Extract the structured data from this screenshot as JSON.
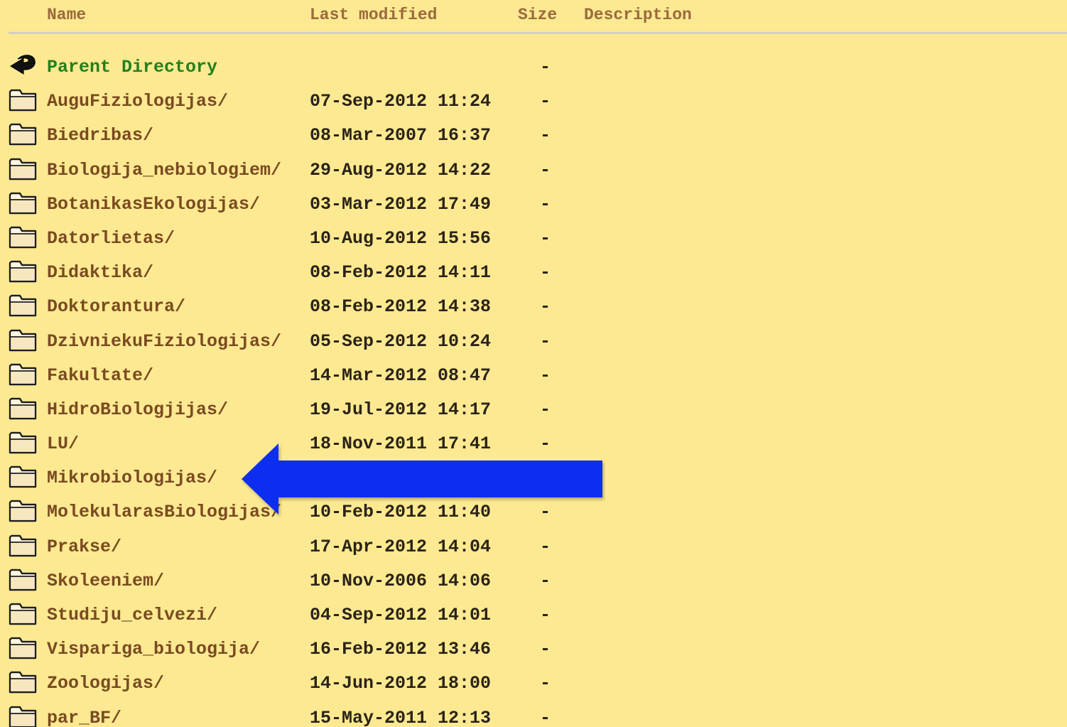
{
  "header": {
    "name": "Name",
    "last_modified": "Last modified",
    "size": "Size",
    "description": "Description"
  },
  "parent": {
    "name": "Parent Directory",
    "size": "-",
    "icon": "back-arrow-icon"
  },
  "entries": [
    {
      "name": "AuguFiziologijas/",
      "modified": "07-Sep-2012 11:24",
      "size": "-"
    },
    {
      "name": "Biedribas/",
      "modified": "08-Mar-2007 16:37",
      "size": "-"
    },
    {
      "name": "Biologija_nebiologiem/",
      "modified": "29-Aug-2012 14:22",
      "size": "-"
    },
    {
      "name": "BotanikasEkologijas/",
      "modified": "03-Mar-2012 17:49",
      "size": "-"
    },
    {
      "name": "Datorlietas/",
      "modified": "10-Aug-2012 15:56",
      "size": "-"
    },
    {
      "name": "Didaktika/",
      "modified": "08-Feb-2012 14:11",
      "size": "-"
    },
    {
      "name": "Doktorantura/",
      "modified": "08-Feb-2012 14:38",
      "size": "-"
    },
    {
      "name": "DzivniekuFiziologijas/",
      "modified": "05-Sep-2012 10:24",
      "size": "-"
    },
    {
      "name": "Fakultate/",
      "modified": "14-Mar-2012 08:47",
      "size": "-"
    },
    {
      "name": "HidroBiologjijas/",
      "modified": "19-Jul-2012 14:17",
      "size": "-"
    },
    {
      "name": "LU/",
      "modified": "18-Nov-2011 17:41",
      "size": "-"
    },
    {
      "name": "Mikrobiologijas/",
      "modified": "",
      "size": ""
    },
    {
      "name": "MolekularasBiologijas/",
      "modified": "10-Feb-2012 11:40",
      "size": "-"
    },
    {
      "name": "Prakse/",
      "modified": "17-Apr-2012 14:04",
      "size": "-"
    },
    {
      "name": "Skoleeniem/",
      "modified": "10-Nov-2006 14:06",
      "size": "-"
    },
    {
      "name": "Studiju_celvezi/",
      "modified": "04-Sep-2012 14:01",
      "size": "-"
    },
    {
      "name": "Vispariga_biologija/",
      "modified": "16-Feb-2012 13:46",
      "size": "-"
    },
    {
      "name": "Zoologijas/",
      "modified": "14-Jun-2012 18:00",
      "size": "-"
    },
    {
      "name": "par_BF/",
      "modified": "15-May-2011 12:13",
      "size": "-"
    }
  ],
  "annotation": {
    "icon": "left-arrow-annotation-icon",
    "color": "#0a2ef0"
  },
  "colors": {
    "background": "#fce991",
    "link": "#7a4a21",
    "parent_link": "#23801c",
    "text": "#2b2317"
  }
}
